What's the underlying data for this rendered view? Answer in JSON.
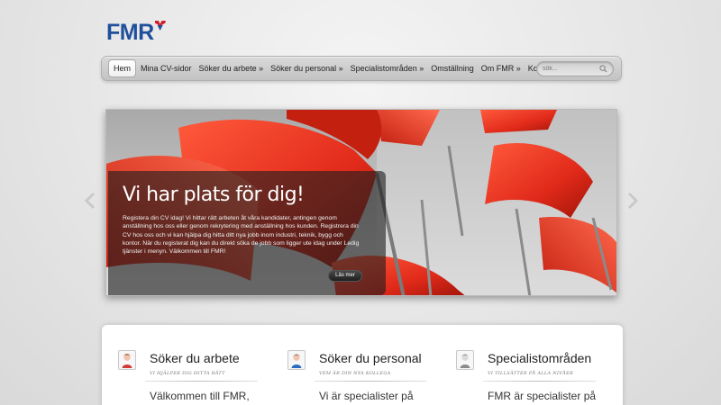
{
  "logo": {
    "text": "FMR"
  },
  "nav": {
    "items": [
      {
        "label": "Hem",
        "active": true
      },
      {
        "label": "Mina CV-sidor"
      },
      {
        "label": "Söker du arbete »"
      },
      {
        "label": "Söker du personal »"
      },
      {
        "label": "Specialistområden »"
      },
      {
        "label": "Omställning"
      },
      {
        "label": "Om FMR »"
      },
      {
        "label": "Kontakt"
      }
    ],
    "search_placeholder": "sök..."
  },
  "slider": {
    "heading": "Vi har plats för dig!",
    "body": "Registera din CV idag! Vi hittar rätt arbeten åt våra kandidater, antingen genom anställning hos oss eller genom rekrytering med anställning hos kunden. Registrera din CV hos oss och vi kan hjälpa dig hitta ditt nya jobb inom industri, teknik, bygg och kontor. När du registerat dig kan du direkt söka de jobb som ligger ute idag under Ledig tjänster i menyn. Välkommen till FMR!",
    "button_label": "Läs mer",
    "accent_color": "#e2311f"
  },
  "columns": [
    {
      "title": "Söker du arbete",
      "subtitle": "VI HJÄLPER DIG HITTA RÄTT",
      "text": "Välkommen till FMR,",
      "icon": "female-person-icon"
    },
    {
      "title": "Söker du personal",
      "subtitle": "VEM ÄR DIN NYA KOLLEGA",
      "text": "Vi är specialister på",
      "icon": "male-person-icon"
    },
    {
      "title": "Specialistområden",
      "subtitle": "VI TILLSÄTTER PÅ ALLA NIVÅER",
      "text": "FMR är specialister på",
      "icon": "grey-person-icon"
    }
  ]
}
